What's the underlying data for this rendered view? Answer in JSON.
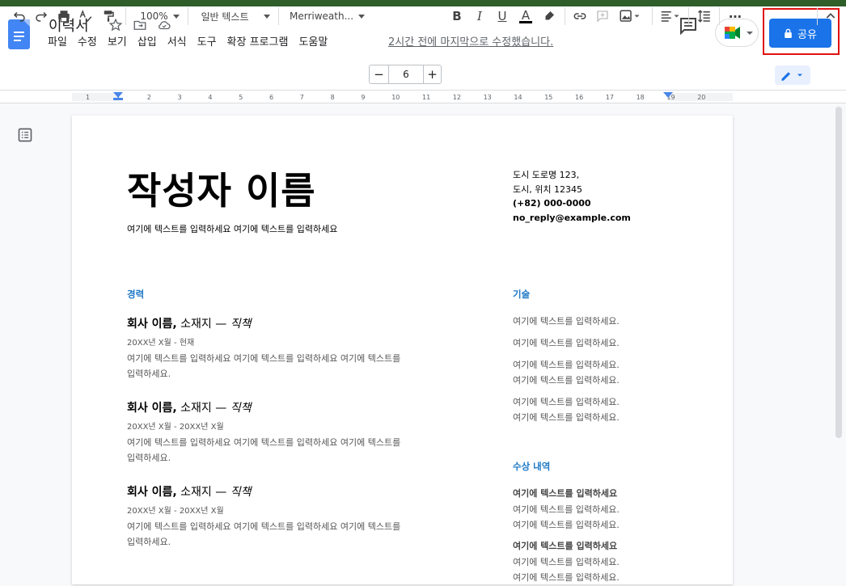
{
  "doc": {
    "title": "이력서"
  },
  "menu": [
    "파일",
    "수정",
    "보기",
    "삽입",
    "서식",
    "도구",
    "확장 프로그램",
    "도움말"
  ],
  "last_edit": "2시간 전에 마지막으로 수정했습니다.",
  "share": {
    "label": "공유"
  },
  "toolbar": {
    "zoom": "100%",
    "style": "일반 텍스트",
    "font": "Merriweath...",
    "font_size": "6",
    "minus": "−",
    "plus": "+",
    "bold": "B",
    "italic": "I",
    "underline": "U",
    "text_color": "A",
    "more": "⋯"
  },
  "ruler": {
    "ticks": [
      "1",
      "1",
      "2",
      "3",
      "4",
      "5",
      "6",
      "7",
      "8",
      "9",
      "10",
      "11",
      "12",
      "13",
      "14",
      "15",
      "16",
      "17",
      "18",
      "19",
      "20"
    ]
  },
  "resume": {
    "name": "작성자 이름",
    "subtitle": "여기에 텍스트를 입력하세요 여기에 텍스트를 입력하세요",
    "contact": {
      "address1": "도시 도로명 123,",
      "address2": "도시, 위치 12345",
      "phone": "(+82) 000-0000",
      "email": "no_reply@example.com"
    },
    "experience_heading": "경력",
    "jobs": [
      {
        "company": "회사 이름,",
        "location": " 소재지 — ",
        "role": "직책",
        "dates": "20XX년 X월 - 현재",
        "desc1": "여기에 텍스트를 입력하세요 여기에 텍스트를 입력하세요 여기에 텍스트를",
        "desc2": "입력하세요."
      },
      {
        "company": "회사 이름,",
        "location": " 소재지 — ",
        "role": "직책",
        "dates": "20XX년 X월 - 20XX년 X월",
        "desc1": "여기에 텍스트를 입력하세요 여기에 텍스트를 입력하세요 여기에 텍스트를",
        "desc2": "입력하세요."
      },
      {
        "company": "회사 이름,",
        "location": " 소재지 — ",
        "role": "직책",
        "dates": "20XX년 X월 - 20XX년 X월",
        "desc1": "여기에 텍스트를 입력하세요 여기에 텍스트를 입력하세요 여기에 텍스트를",
        "desc2": "입력하세요."
      }
    ],
    "skills_heading": "기술",
    "skills": [
      "여기에 텍스트를 입력하세요.",
      "여기에 텍스트를 입력하세요.",
      "여기에 텍스트를 입력하세요.",
      "여기에 텍스트를 입력하세요.",
      "여기에 텍스트를 입력하세요.",
      "여기에 텍스트를 입력하세요."
    ],
    "awards_heading": "수상 내역",
    "awards": [
      {
        "title": "여기에 텍스트를 입력하세요",
        "l1": "여기에 텍스트를 입력하세요.",
        "l2": "여기에 텍스트를 입력하세요."
      },
      {
        "title": "여기에 텍스트를 입력하세요",
        "l1": "여기에 텍스트를 입력하세요.",
        "l2": "여기에 텍스트를 입력하세요."
      }
    ]
  },
  "colors": {
    "accent": "#1a73e8",
    "heading": "#2079c7",
    "highlight_box": "#e01010"
  }
}
